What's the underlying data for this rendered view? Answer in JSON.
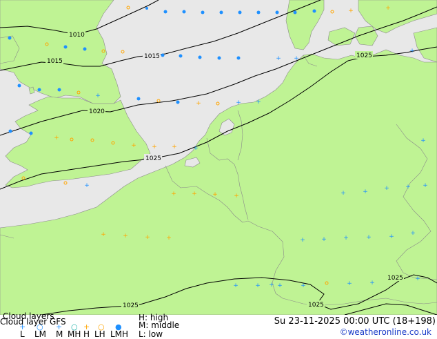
{
  "colors": {
    "sea": "#e8e8e8",
    "land": "#bff394",
    "border": "#8a8a8a",
    "isobar": "#000000",
    "high_cloud": "#1e90ff",
    "middle_cloud": "#ffa500",
    "low_cloud": "#1e90ff",
    "link": "#1a3cc8"
  },
  "isobars": [
    {
      "label": "1010"
    },
    {
      "label": "1015"
    },
    {
      "label": "1015"
    },
    {
      "label": "1020"
    },
    {
      "label": "1025"
    },
    {
      "label": "1025"
    },
    {
      "label": "1025"
    },
    {
      "label": "1025"
    },
    {
      "label": "1025"
    }
  ],
  "footer": {
    "title": "Cloud layers",
    "subtitle": "Cloud layer GFS",
    "legend_codes": [
      "L",
      "LM",
      "M",
      "MH",
      "H",
      "LH",
      "LMH"
    ],
    "legend_icons": [
      "plus-blue",
      "circle-blue",
      "plus-blue",
      "circle-cyan",
      "plus-orange",
      "circle-orange",
      "cloud-blue"
    ],
    "key_high": "H: high",
    "key_middle": "M: middle",
    "key_low": "L: low",
    "datetime": "Su 23-11-2025 00:00 UTC (18+198)",
    "credit": "©weatheronline.co.uk"
  }
}
